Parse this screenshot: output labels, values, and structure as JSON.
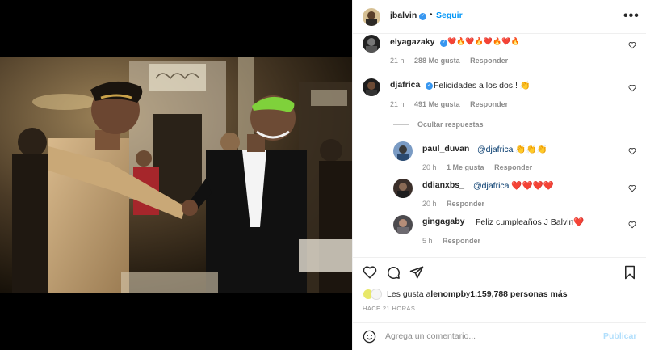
{
  "header": {
    "username": "jbalvin",
    "separator": "•",
    "follow_label": "Seguir",
    "more_label": "•••"
  },
  "comments": [
    {
      "username": "elyagazaky",
      "text": "❤️🔥❤️🔥❤️🔥❤️🔥",
      "time": "21 h",
      "likes": "288 Me gusta",
      "reply_label": "Responder"
    },
    {
      "username": "djafrica",
      "text": "Felicidades a los dos!! 👏",
      "time": "21 h",
      "likes": "491 Me gusta",
      "reply_label": "Responder"
    }
  ],
  "hide_replies_label": "Ocultar respuestas",
  "replies": [
    {
      "username": "paul_duvan",
      "mention": "@djafrica",
      "text": " 👏👏👏",
      "time": "20 h",
      "likes": "1 Me gusta",
      "reply_label": "Responder"
    },
    {
      "username": "ddianxbs_",
      "mention": "@djafrica",
      "text": " ❤️❤️❤️❤️",
      "time": "20 h",
      "reply_label": "Responder"
    },
    {
      "username": "gingagaby",
      "text": "Feliz cumpleaños J Balvin❤️",
      "time": "5 h",
      "reply_label": "Responder"
    }
  ],
  "likes_summary": {
    "prefix": "Les gusta a ",
    "user": "lenompb",
    "conjunction": " y ",
    "count": "1,159,788 personas más"
  },
  "time_ago": "HACE 21 HORAS",
  "composer": {
    "placeholder": "Agrega un comentario...",
    "publish_label": "Publicar"
  },
  "icons": {
    "like": "heart-icon",
    "comment": "comment-icon",
    "share": "share-icon",
    "save": "bookmark-icon",
    "emoji": "emoji-icon"
  },
  "colors": {
    "accent": "#0095f6",
    "verified": "#3897f0",
    "muted": "#8e8e8e"
  }
}
